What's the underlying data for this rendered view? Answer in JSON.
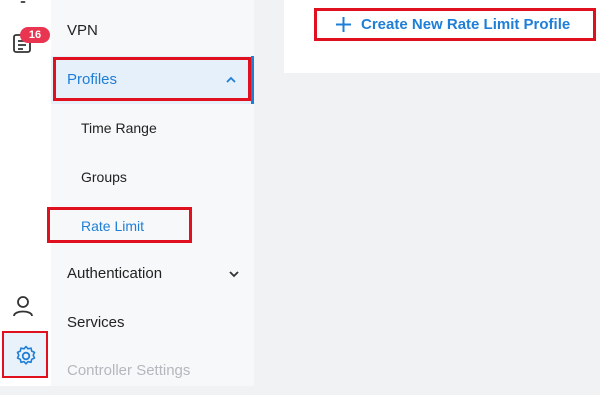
{
  "rail": {
    "notifications_badge": "16",
    "icons": [
      "lightbulb-icon",
      "task-list-icon",
      "user-icon",
      "gear-icon"
    ]
  },
  "menu": {
    "vpn": "VPN",
    "profiles": "Profiles",
    "time_range": "Time Range",
    "groups": "Groups",
    "rate_limit": "Rate Limit",
    "authentication": "Authentication",
    "services": "Services",
    "controller_settings": "Controller Settings"
  },
  "content": {
    "create_button": "Create New Rate Limit Profile"
  },
  "colors": {
    "accent": "#1f7ed6",
    "highlight_border": "#e0101e",
    "badge": "#e9354f"
  }
}
